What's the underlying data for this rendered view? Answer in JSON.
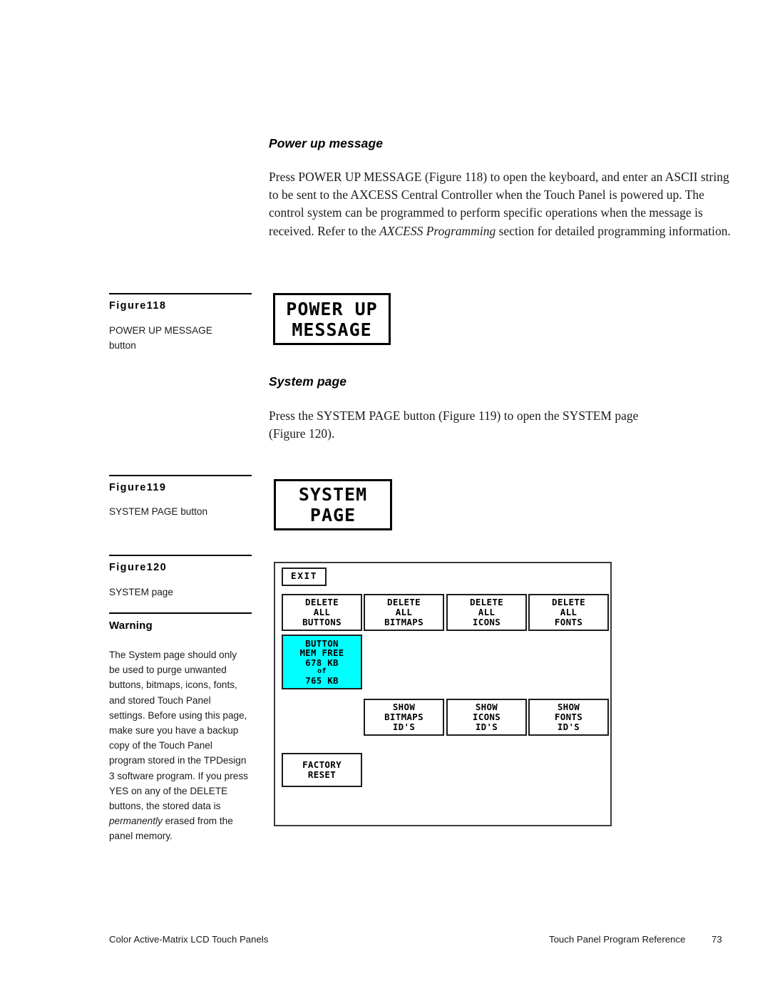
{
  "page": {
    "number": "73"
  },
  "sections": [
    {
      "heading": "Power up message",
      "paragraph_pre": "Press POWER UP MESSAGE (Figure 118) to open the keyboard, and enter an ASCII string to be sent to the AXCESS Central Controller when the Touch Panel is powered up. The control system can be programmed to perform specific operations when the message is received. Refer to the ",
      "paragraph_italic": "AXCESS Programming",
      "paragraph_post": " section for detailed programming information."
    },
    {
      "heading": "System page",
      "paragraph": "Press the SYSTEM PAGE button (Figure 119) to open the SYSTEM page (Figure 120)."
    }
  ],
  "figures": {
    "fig118": {
      "label": "Figure118",
      "caption_line1": "POWER UP MESSAGE",
      "caption_line2": "button",
      "button_line1": "POWER UP",
      "button_line2": "MESSAGE"
    },
    "fig119": {
      "label": "Figure119",
      "caption": "SYSTEM PAGE button",
      "button_line1": "SYSTEM",
      "button_line2": "PAGE"
    },
    "fig120": {
      "label": "Figure120",
      "caption": "SYSTEM page"
    }
  },
  "warning": {
    "label": "Warning",
    "text_pre": "The System page should only be used to purge unwanted buttons, bitmaps, icons, fonts, and stored Touch Panel settings. Before using this page, make sure you have a backup copy of the Touch Panel program stored in the TPDesign 3 software program. If you press YES on any of the DELETE buttons, the stored data is ",
    "text_italic": "permanently",
    "text_post": " erased from the panel memory."
  },
  "system_page": {
    "accent_color": "#00ffff",
    "exit": "EXIT",
    "delete_buttons": [
      "DELETE\nALL\nBUTTONS",
      "DELETE\nALL\nBITMAPS",
      "DELETE\nALL\nICONS",
      "DELETE\nALL\nFONTS"
    ],
    "memory": {
      "line1": "BUTTON",
      "line2": "MEM FREE",
      "line3": "678 KB",
      "line4": "of",
      "line5": "765 KB"
    },
    "show_buttons": [
      "SHOW\nBITMAPS\nID'S",
      "SHOW\nICONS\nID'S",
      "SHOW\nFONTS\nID'S"
    ],
    "factory_reset": "FACTORY\nRESET"
  },
  "footer": {
    "left": "Color Active-Matrix LCD Touch Panels",
    "right": "Touch Panel Program Reference",
    "page": "73"
  }
}
